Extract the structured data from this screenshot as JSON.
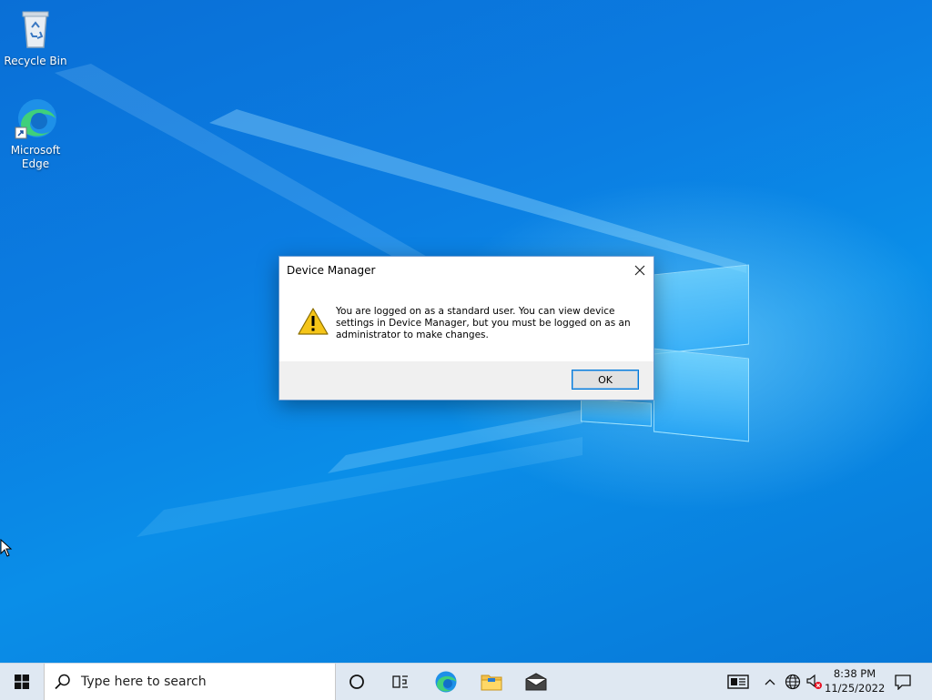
{
  "desktop": {
    "icons": [
      {
        "label": "Recycle Bin",
        "icon": "recycle-bin-icon"
      },
      {
        "label": "Microsoft Edge",
        "icon": "edge-icon"
      }
    ]
  },
  "dialog": {
    "title": "Device Manager",
    "message": "You are logged on as a standard user. You can view device settings in Device Manager, but you must be logged on as an administrator to make changes.",
    "ok_label": "OK",
    "icon": "warning-icon"
  },
  "taskbar": {
    "search_placeholder": "Type here to search",
    "pinned": [
      "cortana-icon",
      "task-view-icon",
      "edge-icon",
      "file-explorer-icon",
      "mail-icon"
    ],
    "tray": [
      "news-icon",
      "chevron-up-icon",
      "network-icon",
      "volume-muted-icon",
      "notification-icon"
    ],
    "time": "8:38 PM",
    "date": "11/25/2022"
  },
  "colors": {
    "accent": "#0078d7",
    "desktop": "#0a7fe0"
  }
}
